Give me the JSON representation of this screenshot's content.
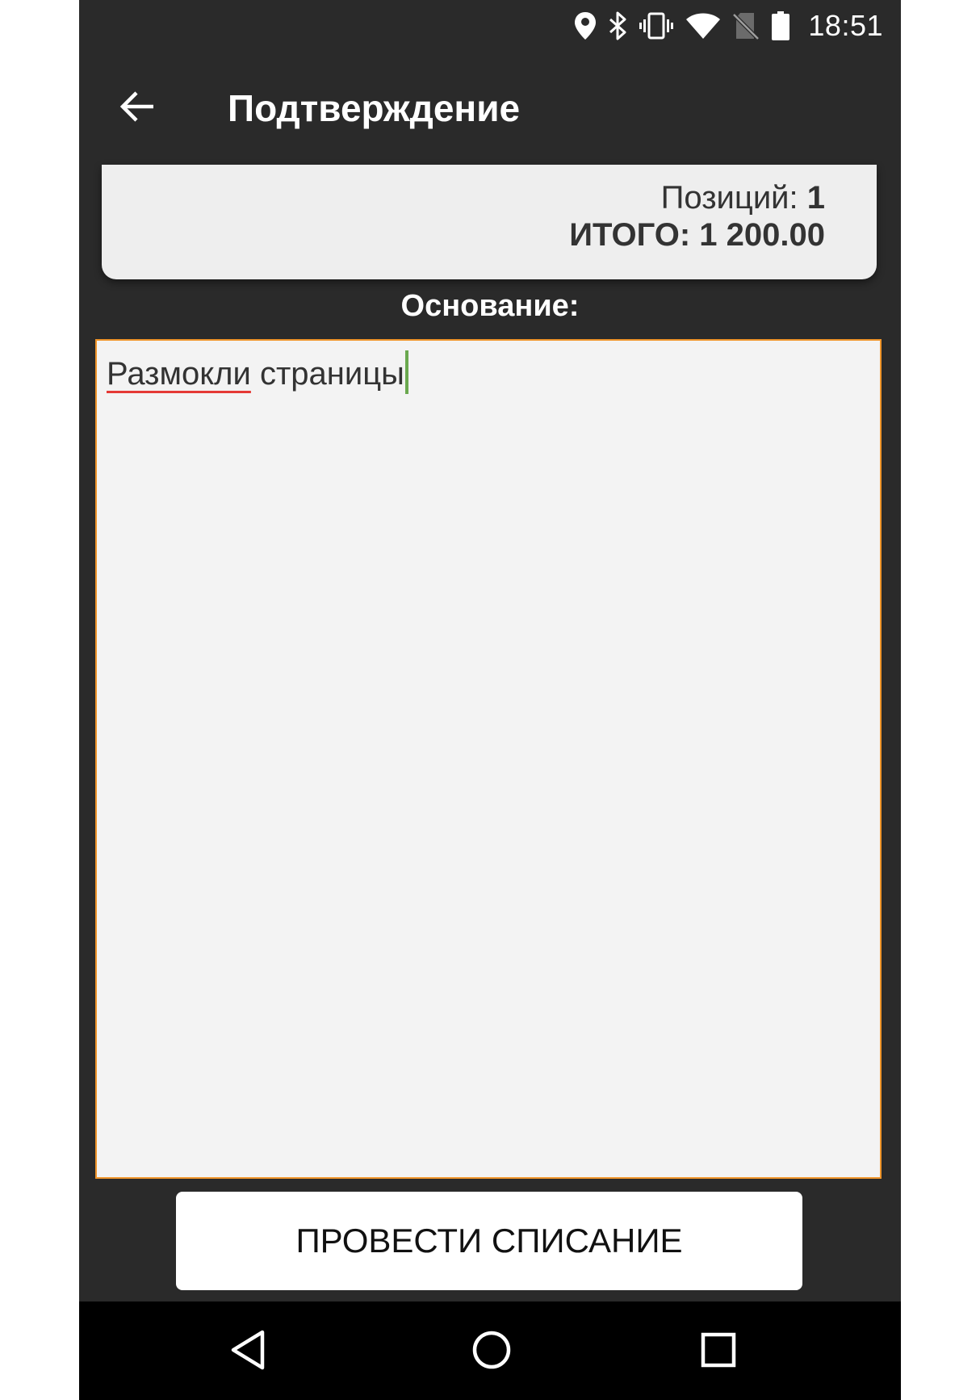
{
  "status_bar": {
    "time": "18:51",
    "icons": [
      "location-icon",
      "bluetooth-icon",
      "vibrate-icon",
      "wifi-icon",
      "no-sim-icon",
      "battery-icon"
    ]
  },
  "app_bar": {
    "title": "Подтверждение",
    "back_icon": "arrow-back-icon"
  },
  "summary": {
    "positions_label": "Позиций:",
    "positions_value": "1",
    "total_label": "ИТОГО:",
    "total_value": "1 200.00"
  },
  "reason": {
    "label": "Основание:",
    "value_misspelled_word": "Размокли",
    "value_rest": " страницы"
  },
  "actions": {
    "submit_label": "ПРОВЕСТИ СПИСАНИЕ"
  },
  "nav_bar": {
    "icons": [
      "back-triangle-icon",
      "home-circle-icon",
      "recents-square-icon"
    ]
  },
  "colors": {
    "background": "#2a2a2a",
    "card": "#eeeeee",
    "input_border": "#f0952a",
    "caret": "#6aa84f",
    "spellcheck": "#e53935"
  }
}
